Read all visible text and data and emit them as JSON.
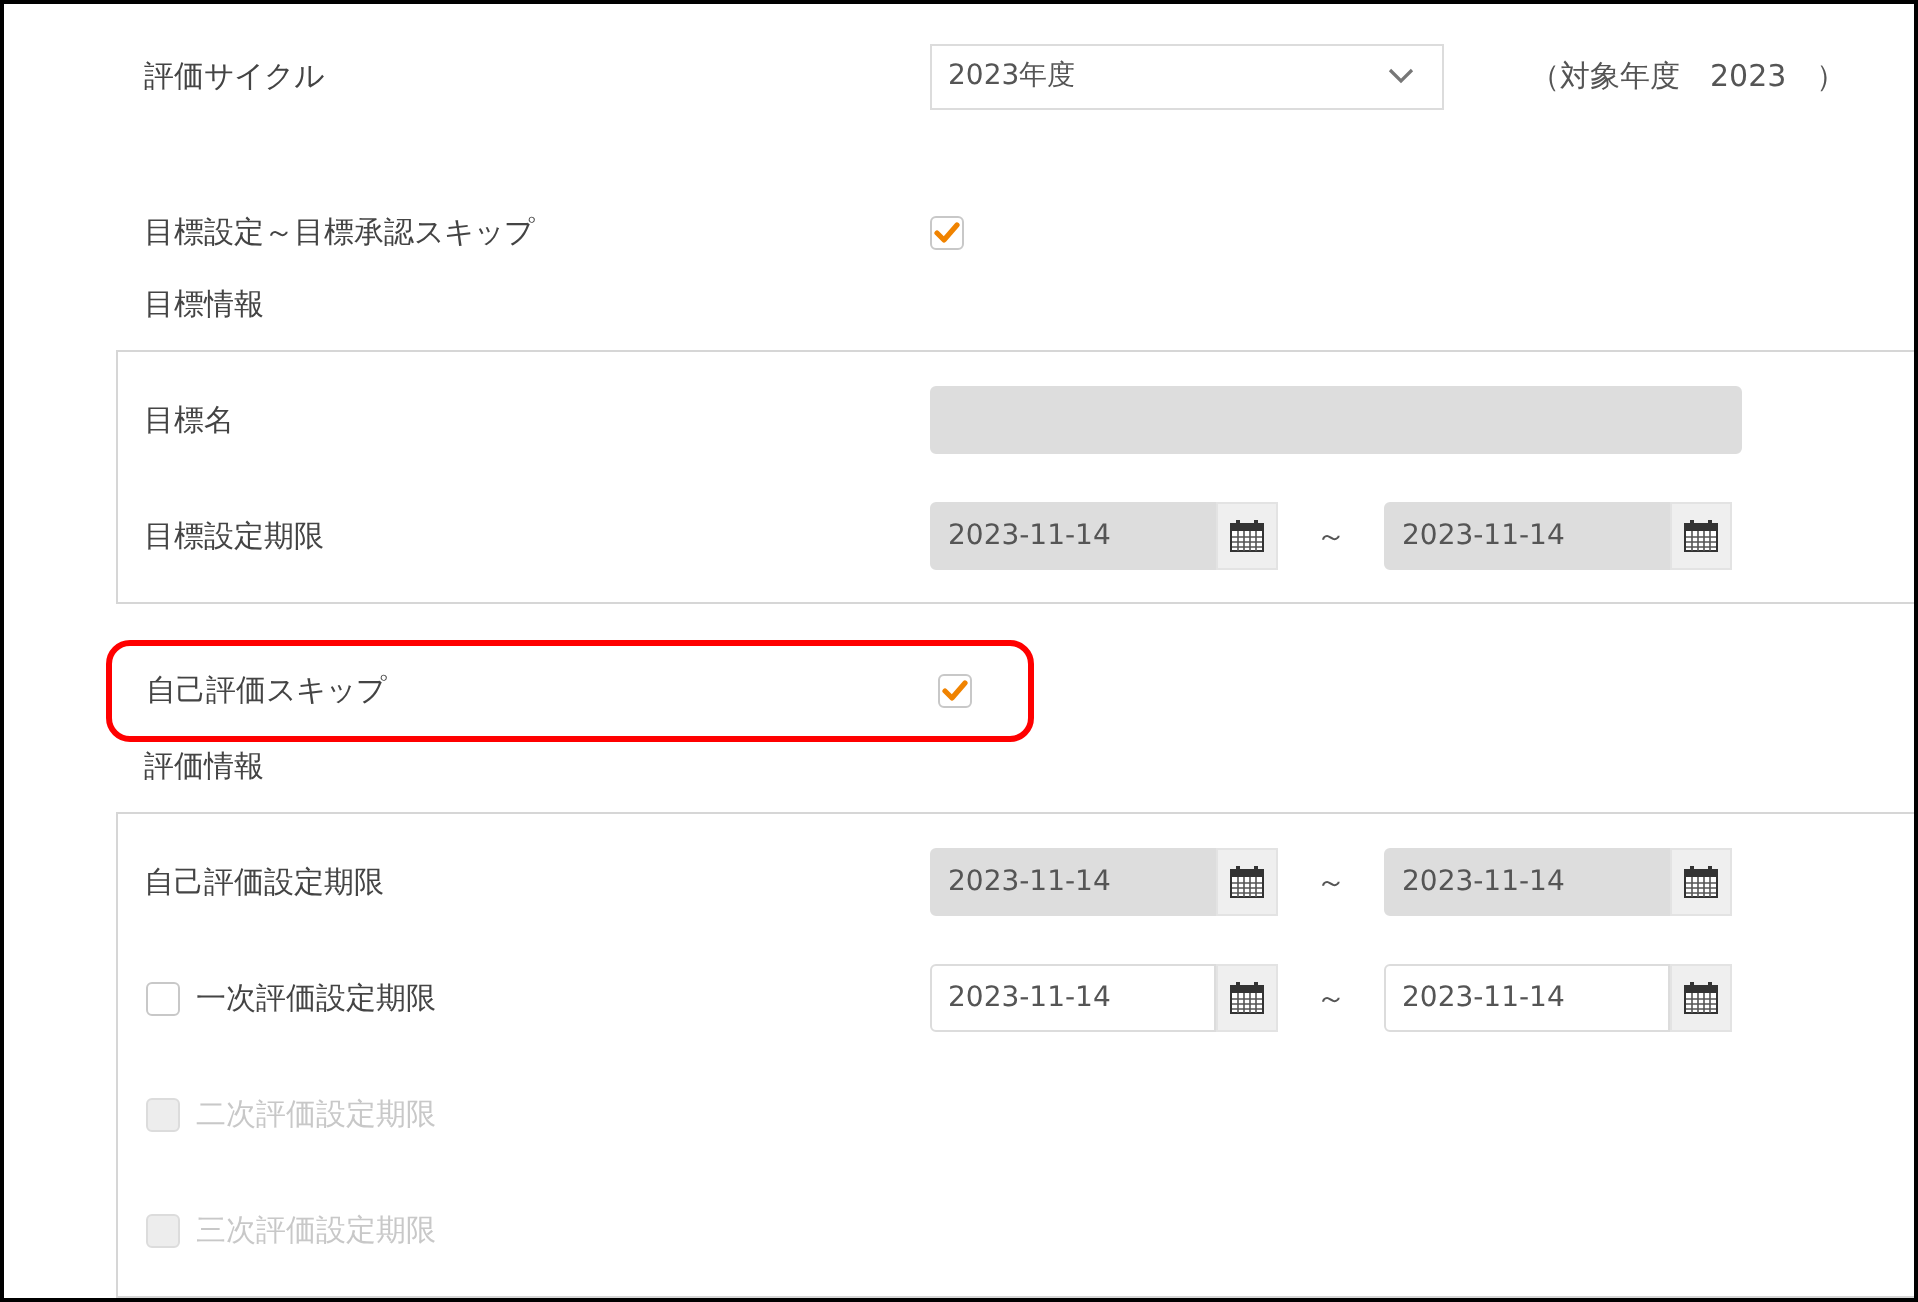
{
  "cycle": {
    "label": "評価サイクル",
    "value": "2023年度",
    "target_note": "（対象年度　2023　）"
  },
  "skip_goal": {
    "label": "目標設定～目標承認スキップ",
    "checked": true
  },
  "goal_section": {
    "title": "目標情報",
    "rows": [
      {
        "kind": "text",
        "label": "目標名",
        "disabled": true
      },
      {
        "kind": "dates",
        "label": "目標設定期限",
        "from": "2023-11-14",
        "separator": "～",
        "to": "2023-11-14",
        "disabled": true
      }
    ]
  },
  "self_skip": {
    "label": "自己評価スキップ",
    "checked": true,
    "highlighted": true
  },
  "eval_section": {
    "title": "評価情報",
    "rows": [
      {
        "kind": "dates",
        "label": "自己評価設定期限",
        "from": "2023-11-14",
        "separator": "～",
        "to": "2023-11-14",
        "disabled": true
      },
      {
        "kind": "check_dates",
        "label": "一次評価設定期限",
        "checked": false,
        "disabled": false,
        "from": "2023-11-14",
        "separator": "～",
        "to": "2023-11-14"
      },
      {
        "kind": "check",
        "label": "二次評価設定期限",
        "checked": false,
        "disabled": true
      },
      {
        "kind": "check",
        "label": "三次評価設定期限",
        "checked": false,
        "disabled": true
      }
    ]
  }
}
